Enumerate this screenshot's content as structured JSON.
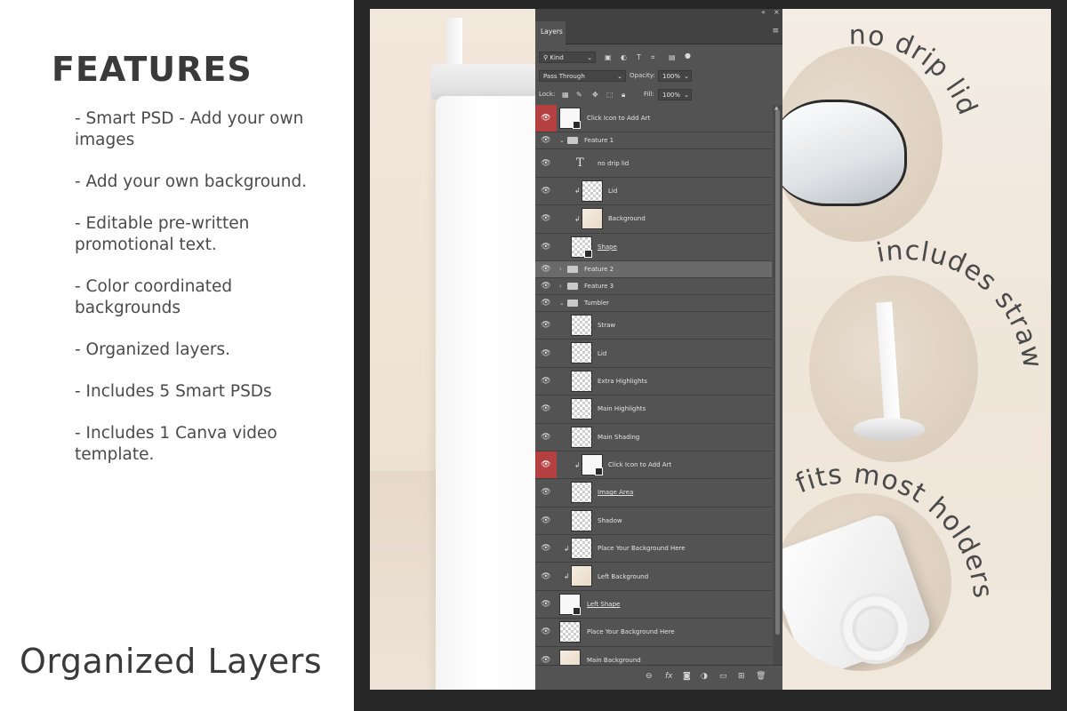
{
  "features": {
    "heading": "FEATURES",
    "items": [
      "- Smart PSD - Add your own\n   images",
      "- Add your own background.",
      "- Editable pre-written\n  promotional text.",
      "- Color coordinated\n   backgrounds",
      "- Organized layers.",
      "- Includes 5 Smart PSDs",
      "- Includes 1 Canva video\n  template."
    ],
    "footer_title": "Organized Layers"
  },
  "right_mockup": {
    "label_1": "no drip lid",
    "label_2": "includes straw",
    "label_3": "fits most holders"
  },
  "panel": {
    "tab_label": "Layers",
    "collapse_icon": "«",
    "close_icon": "×",
    "menu_icon": "≡",
    "filter_kind": "Kind",
    "blend_mode": "Pass Through",
    "opacity_label": "Opacity:",
    "opacity_value": "100%",
    "lock_label": "Lock:",
    "fill_label": "Fill:",
    "fill_value": "100%",
    "layers": [
      {
        "name": "Click Icon to Add Art"
      },
      {
        "name": "Feature 1"
      },
      {
        "name": "no drip lid"
      },
      {
        "name": "Lid"
      },
      {
        "name": "Background"
      },
      {
        "name": "Shape"
      },
      {
        "name": "Feature 2"
      },
      {
        "name": "Feature 3"
      },
      {
        "name": "Tumbler"
      },
      {
        "name": "Straw"
      },
      {
        "name": "Lid"
      },
      {
        "name": "Extra Highlights"
      },
      {
        "name": "Main Highlights"
      },
      {
        "name": "Main Shading"
      },
      {
        "name": "Click Icon to Add Art"
      },
      {
        "name": "Image Area"
      },
      {
        "name": "Shadow"
      },
      {
        "name": "Place Your Background Here"
      },
      {
        "name": "Left Background"
      },
      {
        "name": "Left Shape"
      },
      {
        "name": "Place Your Background Here"
      },
      {
        "name": "Main Background"
      }
    ]
  },
  "colors": {
    "frame": "#262626",
    "panel": "#535353",
    "selected_row": "#6a6a6a",
    "smart_object_eye": "#b54040"
  }
}
